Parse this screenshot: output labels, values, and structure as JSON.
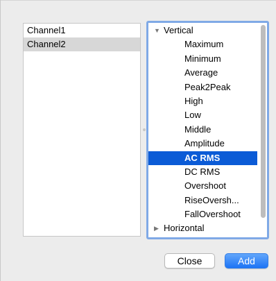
{
  "channels": {
    "items": [
      {
        "label": "Channel1",
        "selected": false
      },
      {
        "label": "Channel2",
        "selected": true
      }
    ]
  },
  "measurements": {
    "groups": [
      {
        "label": "Vertical",
        "expanded": true,
        "items": [
          "Maximum",
          "Minimum",
          "Average",
          "Peak2Peak",
          "High",
          "Low",
          "Middle",
          "Amplitude",
          "AC RMS",
          "DC RMS",
          "Overshoot",
          "RiseOversh...",
          "FallOvershoot"
        ]
      },
      {
        "label": "Horizontal",
        "expanded": false,
        "items": []
      }
    ],
    "selected_item": "AC RMS"
  },
  "buttons": {
    "close_label": "Close",
    "add_label": "Add"
  },
  "colors": {
    "selection": "#0b5bd6",
    "focus_ring": "#7fa9e6",
    "default_button": "#1d74f5"
  }
}
